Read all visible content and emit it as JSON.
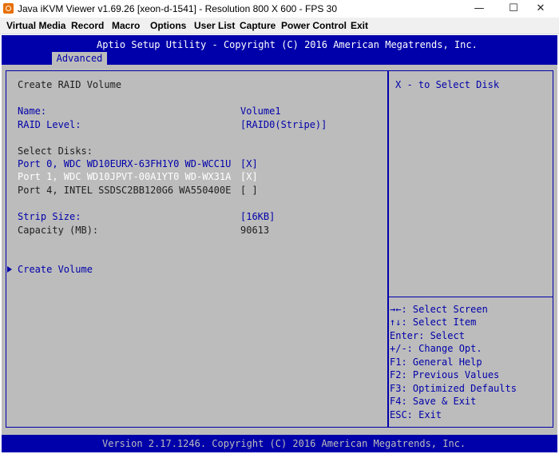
{
  "window": {
    "title": "Java iKVM Viewer v1.69.26 [xeon-d-1541]  - Resolution 800 X 600 - FPS 30",
    "minimize": "—",
    "maximize": "☐",
    "close": "✕"
  },
  "menu": [
    "Virtual Media",
    "Record",
    "Macro",
    "Options",
    "User List",
    "Capture",
    "Power Control",
    "Exit"
  ],
  "bios": {
    "title": "Aptio Setup Utility - Copyright (C) 2016 American Megatrends, Inc.",
    "tab": "Advanced",
    "section_title": "Create RAID Volume",
    "name_label": "Name:",
    "name_value": "Volume1",
    "raid_level_label": "RAID Level:",
    "raid_level_value": "[RAID0(Stripe)]",
    "select_disks_label": "Select Disks:",
    "disks": [
      {
        "label": "Port 0, WDC WD10EURX-63FH1Y0 WD-WCC1U",
        "value": "[X]"
      },
      {
        "label": "Port 1, WDC WD10JPVT-00A1YT0 WD-WX31A",
        "value": "[X]"
      },
      {
        "label": "Port 4, INTEL SSDSC2BB120G6 WA550400E",
        "value": "[ ]"
      }
    ],
    "strip_size_label": "Strip Size:",
    "strip_size_value": "[16KB]",
    "capacity_label": "Capacity (MB):",
    "capacity_value": "90613",
    "create_volume": "Create Volume",
    "help_text": "X - to Select Disk",
    "keys": [
      {
        "key": "→←:",
        "desc": " Select Screen"
      },
      {
        "key": "↑↓:",
        "desc": " Select Item"
      },
      {
        "key": "",
        "desc": "Enter: Select"
      },
      {
        "key": "",
        "desc": "+/-: Change Opt."
      },
      {
        "key": "",
        "desc": "F1: General Help"
      },
      {
        "key": "",
        "desc": "F2: Previous Values"
      },
      {
        "key": "",
        "desc": "F3: Optimized Defaults"
      },
      {
        "key": "",
        "desc": "F4: Save & Exit"
      },
      {
        "key": "",
        "desc": "ESC: Exit"
      }
    ],
    "footer": "Version 2.17.1246. Copyright (C) 2016 American Megatrends, Inc."
  },
  "colors": {
    "bios_blue": "#0000aa",
    "bios_gray": "#bcbcbc",
    "bios_highlight": "#ffffff"
  }
}
